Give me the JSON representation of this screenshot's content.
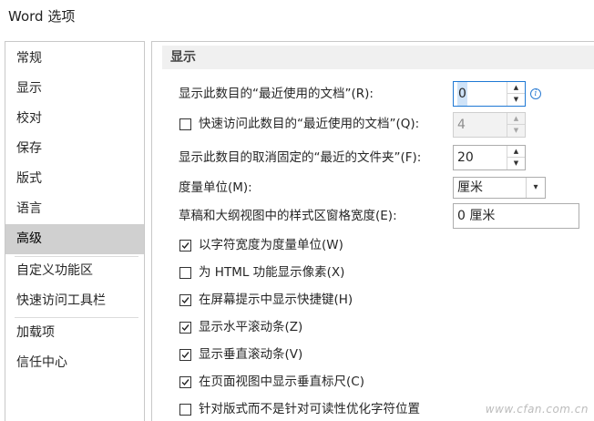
{
  "window": {
    "title": "Word 选项"
  },
  "sidebar": {
    "items": [
      {
        "label": "常规"
      },
      {
        "label": "显示"
      },
      {
        "label": "校对"
      },
      {
        "label": "保存"
      },
      {
        "label": "版式"
      },
      {
        "label": "语言"
      },
      {
        "label": "高级",
        "selected": true
      },
      {
        "label": "自定义功能区"
      },
      {
        "label": "快速访问工具栏"
      },
      {
        "label": "加载项"
      },
      {
        "label": "信任中心"
      }
    ]
  },
  "panel": {
    "section_title": "显示",
    "recent_docs": {
      "label": "显示此数目的“最近使用的文档”(R):",
      "value": "0"
    },
    "quick_access": {
      "label": "快速访问此数目的“最近使用的文档”(Q):",
      "value": "4",
      "checked": false,
      "disabled": true
    },
    "unpinned_folders": {
      "label": "显示此数目的取消固定的“最近的文件夹”(F):",
      "value": "20"
    },
    "measure_units": {
      "label": "度量单位(M):",
      "value": "厘米"
    },
    "style_area_width": {
      "label": "草稿和大纲视图中的样式区窗格宽度(E):",
      "value": "0 厘米"
    },
    "checkboxes": [
      {
        "label": "以字符宽度为度量单位(W)",
        "checked": true
      },
      {
        "label": "为 HTML 功能显示像素(X)",
        "checked": false
      },
      {
        "label": "在屏幕提示中显示快捷键(H)",
        "checked": true
      },
      {
        "label": "显示水平滚动条(Z)",
        "checked": true
      },
      {
        "label": "显示垂直滚动条(V)",
        "checked": true
      },
      {
        "label": "在页面视图中显示垂直标尺(C)",
        "checked": true
      },
      {
        "label": "针对版式而不是针对可读性优化字符位置",
        "checked": false
      }
    ],
    "icons": {
      "info": "info-icon",
      "dropdown": "chevron-down-icon",
      "spin_up": "spin-up-icon",
      "spin_down": "spin-down-icon"
    }
  },
  "watermark": "www.cfan.com.cn",
  "colors": {
    "selected_bg": "#d0d0d0",
    "focus_border": "#1e78d4",
    "section_bg": "#f0f0f0"
  }
}
